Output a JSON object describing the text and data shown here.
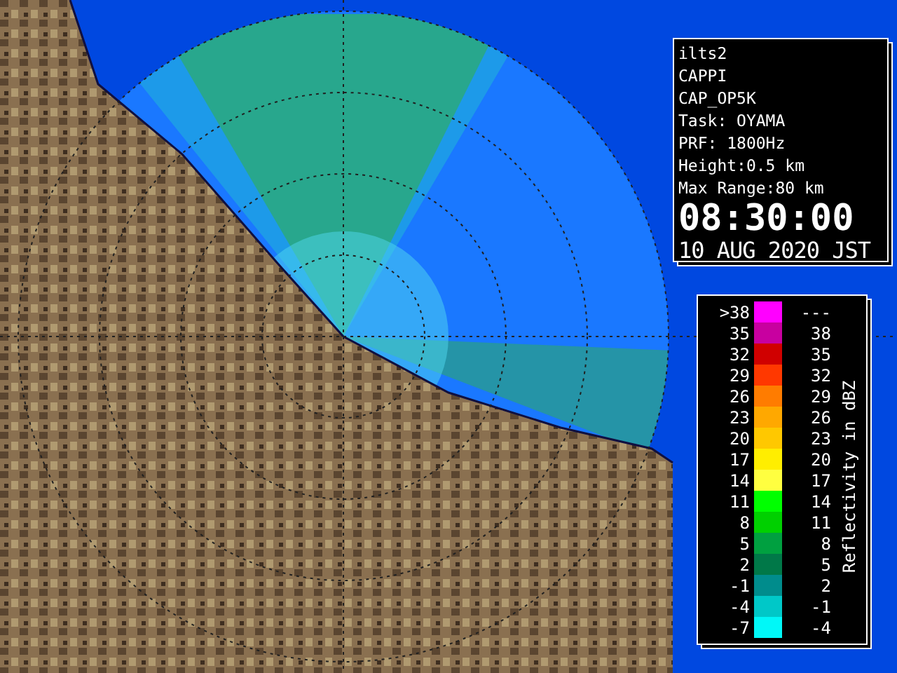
{
  "info_panel": {
    "lines": [
      "ilts2",
      "CAPPI",
      "CAP_OP5K",
      "Task: OYAMA",
      "PRF: 1800Hz",
      "Height:0.5 km",
      "Max Range:80 km"
    ],
    "time": "08:30:00",
    "date": "10 AUG 2020 JST"
  },
  "legend": {
    "title": "Reflectivity in dBZ",
    "rows": [
      {
        "low": ">38",
        "high": "---",
        "color": "#ff00ff"
      },
      {
        "low": "35",
        "high": "38",
        "color": "#c800a0"
      },
      {
        "low": "32",
        "high": "35",
        "color": "#d00000"
      },
      {
        "low": "29",
        "high": "32",
        "color": "#ff3800"
      },
      {
        "low": "26",
        "high": "29",
        "color": "#ff7c00"
      },
      {
        "low": "23",
        "high": "26",
        "color": "#ffa800"
      },
      {
        "low": "20",
        "high": "23",
        "color": "#ffc800"
      },
      {
        "low": "17",
        "high": "20",
        "color": "#ffee00"
      },
      {
        "low": "14",
        "high": "17",
        "color": "#ffff40"
      },
      {
        "low": "11",
        "high": "14",
        "color": "#00ff00"
      },
      {
        "low": "8",
        "high": "11",
        "color": "#00d000"
      },
      {
        "low": "5",
        "high": "8",
        "color": "#00a040"
      },
      {
        "low": "2",
        "high": "5",
        "color": "#007848"
      },
      {
        "low": "-1",
        "high": "2",
        "color": "#008c8c"
      },
      {
        "low": "-4",
        "high": "-1",
        "color": "#00c8c8"
      },
      {
        "low": "-7",
        "high": "-4",
        "color": "#00f8f8"
      }
    ]
  }
}
